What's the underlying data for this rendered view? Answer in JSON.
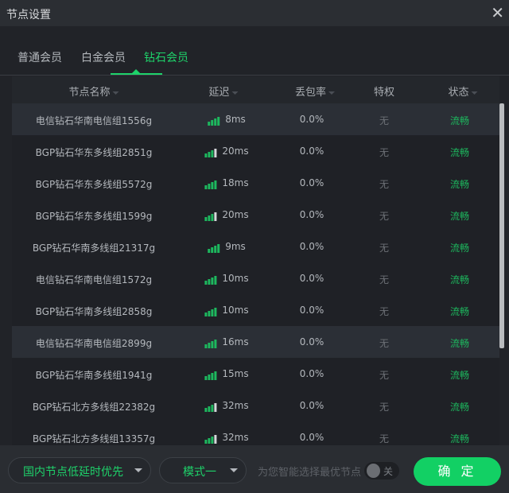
{
  "window": {
    "title": "节点设置",
    "close": "✕"
  },
  "tabs": [
    {
      "label": "普通会员"
    },
    {
      "label": "白金会员"
    },
    {
      "label": "钻石会员",
      "active": true
    }
  ],
  "columns": [
    "节点名称",
    "延迟",
    "丢包率",
    "特权",
    "状态"
  ],
  "colors": {
    "accent": "#1ed26a",
    "bar_on": "#1db85e",
    "bar_off": "#d5d7da"
  },
  "rows": [
    {
      "name": "电信钻石华南电信组1556g",
      "delay": "8ms",
      "signal": 4,
      "loss": "0.0%",
      "priv": "无",
      "status": "流畅",
      "highlight": true
    },
    {
      "name": "BGP钻石华东多线组2851g",
      "delay": "20ms",
      "signal": 3,
      "loss": "0.0%",
      "priv": "无",
      "status": "流畅"
    },
    {
      "name": "BGP钻石华东多线组5572g",
      "delay": "18ms",
      "signal": 4,
      "loss": "0.0%",
      "priv": "无",
      "status": "流畅"
    },
    {
      "name": "BGP钻石华东多线组1599g",
      "delay": "20ms",
      "signal": 3,
      "loss": "0.0%",
      "priv": "无",
      "status": "流畅"
    },
    {
      "name": "BGP钻石华南多线组21317g",
      "delay": "9ms",
      "signal": 4,
      "loss": "0.0%",
      "priv": "无",
      "status": "流畅"
    },
    {
      "name": "电信钻石华南电信组1572g",
      "delay": "10ms",
      "signal": 4,
      "loss": "0.0%",
      "priv": "无",
      "status": "流畅"
    },
    {
      "name": "BGP钻石华南多线组2858g",
      "delay": "10ms",
      "signal": 4,
      "loss": "0.0%",
      "priv": "无",
      "status": "流畅"
    },
    {
      "name": "电信钻石华南电信组2899g",
      "delay": "16ms",
      "signal": 4,
      "loss": "0.0%",
      "priv": "无",
      "status": "流畅",
      "highlight": true
    },
    {
      "name": "BGP钻石华南多线组1941g",
      "delay": "15ms",
      "signal": 4,
      "loss": "0.0%",
      "priv": "无",
      "status": "流畅"
    },
    {
      "name": "BGP钻石北方多线组22382g",
      "delay": "32ms",
      "signal": 3,
      "loss": "0.0%",
      "priv": "无",
      "status": "流畅"
    },
    {
      "name": "BGP钻石北方多线组13357g",
      "delay": "32ms",
      "signal": 3,
      "loss": "0.0%",
      "priv": "无",
      "status": "流畅"
    }
  ],
  "footer": {
    "region_select": "国内节点低延时优先",
    "mode_select": "模式一",
    "smart_hint": "为您智能选择最优节点",
    "toggle_label": "关",
    "toggle_on": false,
    "confirm": "确 定"
  }
}
